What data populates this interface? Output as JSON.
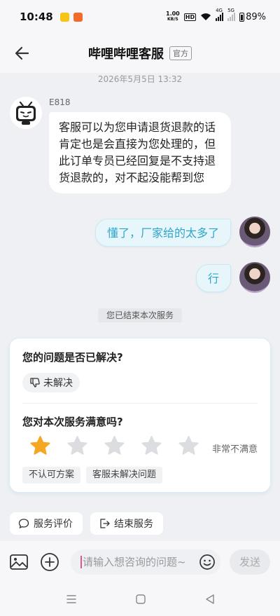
{
  "status_bar": {
    "time": "10:48",
    "speed_value": "1.00",
    "speed_unit": "KB/S",
    "hd_badge": "HD",
    "network_4g": "4G",
    "network_5g": "5G",
    "battery": "89%"
  },
  "header": {
    "title": "哔哩哔哩客服",
    "badge": "官方"
  },
  "chat": {
    "timestamp": "2026年5月5日 13:32",
    "bot_name": "E818",
    "bot_message": "客服可以为您申请退货退款的话肯定也是会直接为您处理的，但此订单专员已经回复是不支持退货退款的，对不起没能帮到您",
    "user_messages": [
      "懂了，厂家给的太多了",
      "行"
    ],
    "system_tip": "您已结束本次服务"
  },
  "survey": {
    "question_resolved": "您的问题是否已解决?",
    "unresolved_label": "未解决",
    "question_satisfaction": "您对本次服务满意吗?",
    "rating": 1,
    "rating_max": 5,
    "rating_text": "非常不满意",
    "tags": [
      "不认可方案",
      "客服未解决问题"
    ]
  },
  "quick_actions": {
    "evaluate": "服务评价",
    "end": "结束服务"
  },
  "input_bar": {
    "placeholder": "请输入想咨询的问题~",
    "send": "发送"
  },
  "colors": {
    "accent": "#2fa5c9",
    "star_active": "#f5a623",
    "star_inactive": "#dcdde0"
  }
}
